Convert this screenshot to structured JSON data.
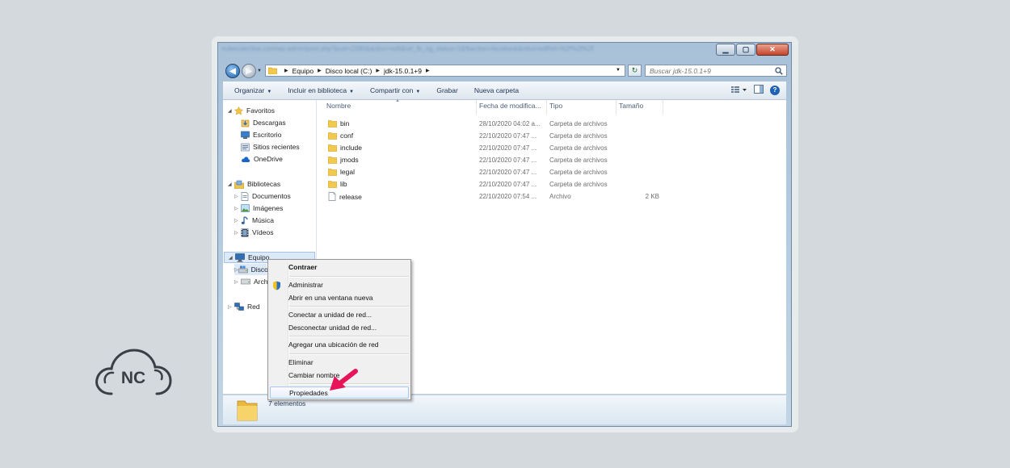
{
  "window": {
    "url_text": "nubecolectiva.com/wp-admin/post.php?post=2280&action=edit&ref_fb_og_status=1&fbaction=facebook&returnedRef=%2f%2f%2f",
    "minimize": "▁",
    "maximize": "▢",
    "close": "✕"
  },
  "address": {
    "crumbs": [
      "Equipo",
      "Disco local (C:)",
      "jdk-15.0.1+9"
    ],
    "search_placeholder": "Buscar jdk-15.0.1+9"
  },
  "toolbar": {
    "items": [
      "Organizar",
      "Incluir en biblioteca",
      "Compartir con",
      "Grabar",
      "Nueva carpeta"
    ]
  },
  "nav": {
    "favorites": "Favoritos",
    "fav_items": [
      "Descargas",
      "Escritorio",
      "Sitios recientes",
      "OneDrive"
    ],
    "libraries": "Bibliotecas",
    "lib_items": [
      "Documentos",
      "Imágenes",
      "Música",
      "Vídeos"
    ],
    "computer": "Equipo",
    "comp_items": [
      "Disco",
      "Arch"
    ],
    "network": "Red"
  },
  "columns": {
    "name": "Nombre",
    "date": "Fecha de modifica...",
    "type": "Tipo",
    "size": "Tamaño"
  },
  "files": [
    {
      "name": "bin",
      "date": "28/10/2020 04:02 a...",
      "type": "Carpeta de archivos",
      "size": "",
      "icon": "folder-icon"
    },
    {
      "name": "conf",
      "date": "22/10/2020 07:47 ...",
      "type": "Carpeta de archivos",
      "size": "",
      "icon": "folder-icon"
    },
    {
      "name": "include",
      "date": "22/10/2020 07:47 ...",
      "type": "Carpeta de archivos",
      "size": "",
      "icon": "folder-icon"
    },
    {
      "name": "jmods",
      "date": "22/10/2020 07:47 ...",
      "type": "Carpeta de archivos",
      "size": "",
      "icon": "folder-icon"
    },
    {
      "name": "legal",
      "date": "22/10/2020 07:47 ...",
      "type": "Carpeta de archivos",
      "size": "",
      "icon": "folder-icon"
    },
    {
      "name": "lib",
      "date": "22/10/2020 07:47 ...",
      "type": "Carpeta de archivos",
      "size": "",
      "icon": "folder-icon"
    },
    {
      "name": "release",
      "date": "22/10/2020 07:54 ...",
      "type": "Archivo",
      "size": "2 KB",
      "icon": "file-icon"
    }
  ],
  "details": {
    "count": "7 elementos"
  },
  "context_menu": {
    "items": [
      "Contraer",
      "Administrar",
      "Abrir en una ventana nueva",
      "Conectar a unidad de red...",
      "Desconectar unidad de red...",
      "Agregar una ubicación de red",
      "Eliminar",
      "Cambiar nombre",
      "Propiedades"
    ]
  },
  "logo": {
    "text": "NC"
  },
  "colors": {
    "accent_arrow": "#e8145a",
    "folder": "#f2c94c"
  }
}
